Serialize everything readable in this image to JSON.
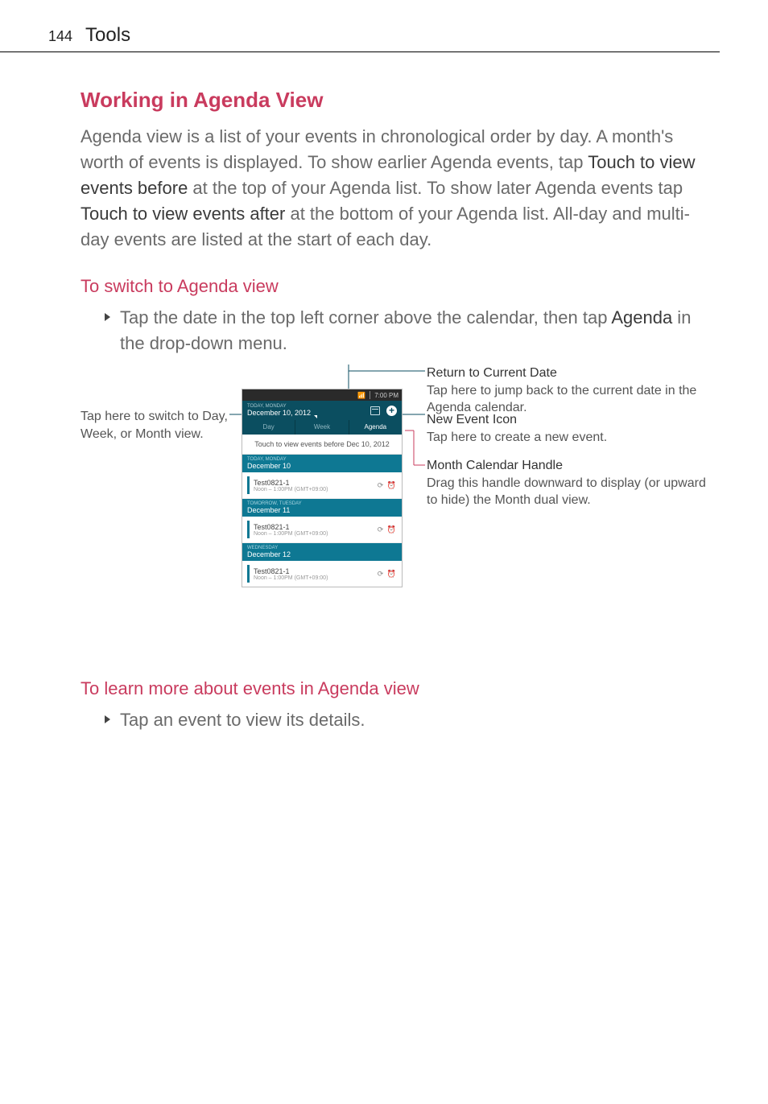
{
  "header": {
    "page_number": "144",
    "section": "Tools"
  },
  "title": "Working in Agenda View",
  "intro_part1": "Agenda view is a list of your events in chronological order by day. A month's worth of events is displayed. To show earlier Agenda events, tap ",
  "intro_strong1": "Touch to view events before",
  "intro_part2": " at the top of your Agenda list. To show later Agenda events tap ",
  "intro_strong2": "Touch to view events after",
  "intro_part3": " at the bottom of your Agenda list. All-day and multi-day events are listed at the start of each day.",
  "sub1_title": "To switch to Agenda view",
  "sub1_bullet_a": "Tap the date in the top left corner above the calendar, then tap ",
  "sub1_bullet_strong": "Agenda",
  "sub1_bullet_b": " in the drop-down menu.",
  "callouts": {
    "left": "Tap here to switch to Day, Week, or Month view.",
    "r1_title": "Return to Current Date",
    "r1_body": "Tap here to jump back to the current date in the Agenda calendar.",
    "r2_title": "New Event Icon",
    "r2_body": "Tap here to create a new event.",
    "r3_title": "Month Calendar Handle",
    "r3_body": "Drag this handle downward to display (or upward to hide) the Month dual view."
  },
  "phone": {
    "status_time": "7:00 PM",
    "titlebar_small": "TODAY, MONDAY",
    "titlebar_date": "December 10, 2012",
    "tabs": {
      "day": "Day",
      "week": "Week",
      "agenda": "Agenda"
    },
    "touch_before": "Touch to view events before Dec 10, 2012",
    "days": [
      {
        "label_small": "TODAY, MONDAY",
        "label": "December 10",
        "event_title": "Test0821-1",
        "event_time": "Noon – 1:00PM (GMT+09:00)"
      },
      {
        "label_small": "TOMORROW, TUESDAY",
        "label": "December 11",
        "event_title": "Test0821-1",
        "event_time": "Noon – 1:00PM (GMT+09:00)"
      },
      {
        "label_small": "WEDNESDAY",
        "label": "December 12",
        "event_title": "Test0821-1",
        "event_time": "Noon – 1:00PM (GMT+09:00)"
      }
    ],
    "event_icons": "⟳ ⏰"
  },
  "sub2_title": "To learn more about events in Agenda view",
  "sub2_bullet": "Tap an event to view its details."
}
